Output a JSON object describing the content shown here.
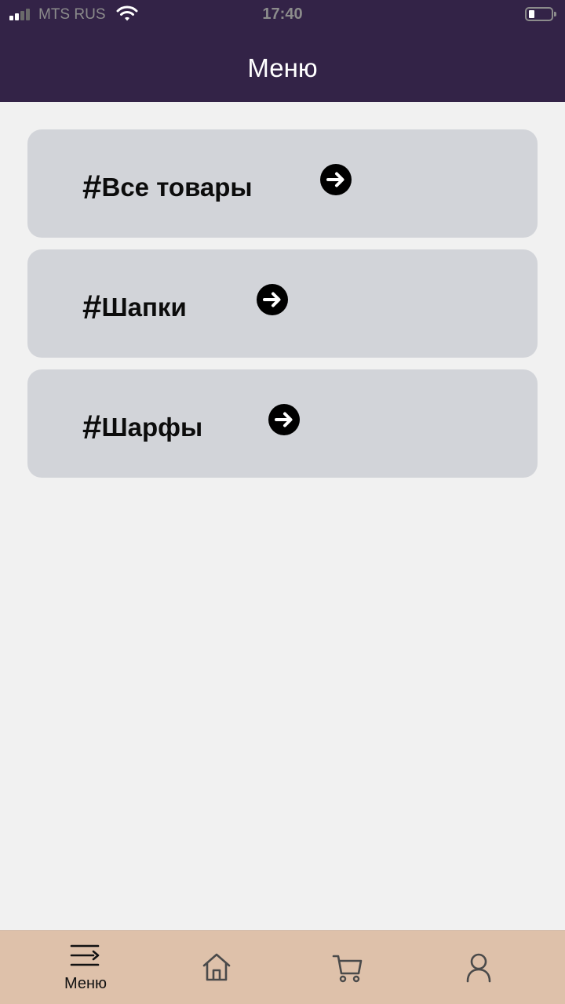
{
  "status_bar": {
    "carrier": "MTS RUS",
    "time": "17:40"
  },
  "header": {
    "title": "Меню",
    "background": "#332347"
  },
  "menu": {
    "items": [
      {
        "hash": "#",
        "label": "Все товары",
        "icon": "arrow-right-circle-icon"
      },
      {
        "hash": "#",
        "label": "Шапки",
        "icon": "arrow-right-circle-icon"
      },
      {
        "hash": "#",
        "label": "Шарфы",
        "icon": "arrow-right-circle-icon"
      }
    ]
  },
  "tabbar": {
    "background": "#dec1aa",
    "tabs": [
      {
        "label": "Меню",
        "icon": "menu-icon",
        "active": true
      },
      {
        "label": "",
        "icon": "home-icon",
        "active": false
      },
      {
        "label": "",
        "icon": "cart-icon",
        "active": false
      },
      {
        "label": "",
        "icon": "profile-icon",
        "active": false
      }
    ]
  }
}
